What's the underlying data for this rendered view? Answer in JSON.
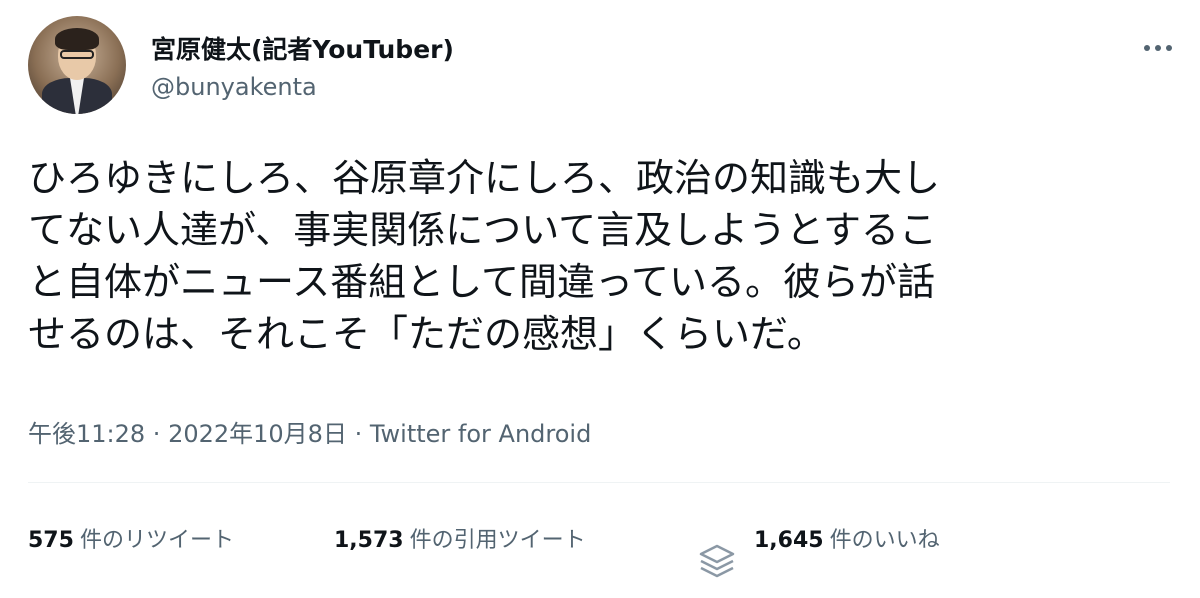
{
  "author": {
    "display_name": "宮原健太(記者YouTuber)",
    "handle": "@bunyakenta"
  },
  "more_icon": "more-horizontal-icon",
  "tweet": {
    "lines": [
      "ひろゆきにしろ、谷原章介にしろ、政治の知識も大し",
      "てない人達が、事実関係について言及しようとするこ",
      "と自体がニュース番組として間違っている。彼らが話",
      "せるのは、それこそ「ただの感想」くらいだ。"
    ]
  },
  "meta": {
    "time": "午後11:28",
    "separator": " · ",
    "date": "2022年10月8日",
    "source": "Twitter for Android"
  },
  "stats": {
    "retweets": {
      "count": "575",
      "label": "件のリツイート"
    },
    "quotes": {
      "count": "1,573",
      "label": "件の引用ツイート"
    },
    "likes": {
      "count": "1,645",
      "label": "件のいいね"
    }
  },
  "colors": {
    "text": "#0f1419",
    "secondary": "#536471",
    "divider": "#eff3f4"
  }
}
